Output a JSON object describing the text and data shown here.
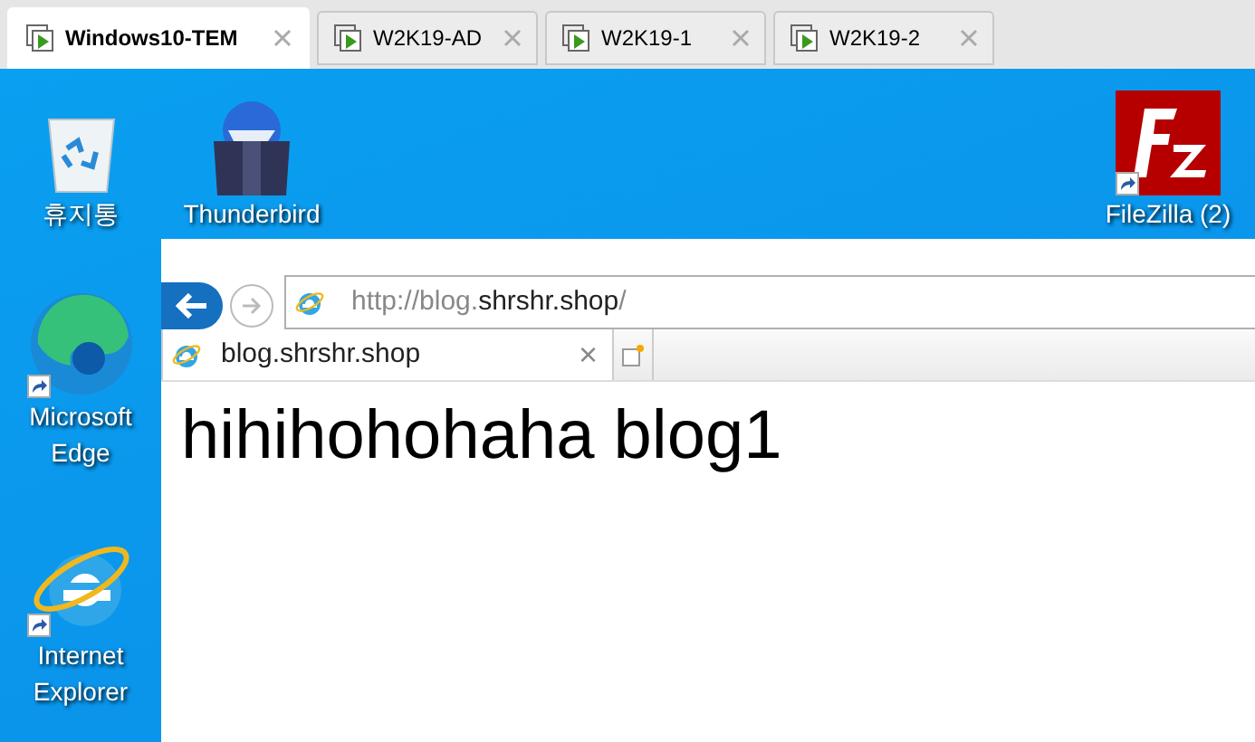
{
  "tabs": [
    {
      "label": "Windows10-TEM",
      "selected": true
    },
    {
      "label": "W2K19-AD",
      "selected": false
    },
    {
      "label": "W2K19-1",
      "selected": false
    },
    {
      "label": "W2K19-2",
      "selected": false
    }
  ],
  "desktop": {
    "left_icons": [
      {
        "kind": "recycle",
        "label": "휴지통",
        "shortcut": false
      },
      {
        "kind": "edge",
        "label": "Microsoft Edge",
        "shortcut": true
      },
      {
        "kind": "ie",
        "label": "Internet Explorer",
        "shortcut": true
      }
    ],
    "top_icons": [
      {
        "kind": "thunderbird",
        "label": "Thunderbird",
        "shortcut": false
      }
    ],
    "right_icons": [
      {
        "kind": "filezilla",
        "label": "FileZilla (2)",
        "shortcut": true
      }
    ]
  },
  "browser": {
    "address": [
      {
        "text": "http://blog.",
        "highlighted": false
      },
      {
        "text": "shrshr.shop",
        "highlighted": true
      },
      {
        "text": "/",
        "highlighted": false
      }
    ],
    "tab": {
      "label": "blog.shrshr.shop",
      "close": "×"
    },
    "heading": "hihihohohaha blog1"
  }
}
